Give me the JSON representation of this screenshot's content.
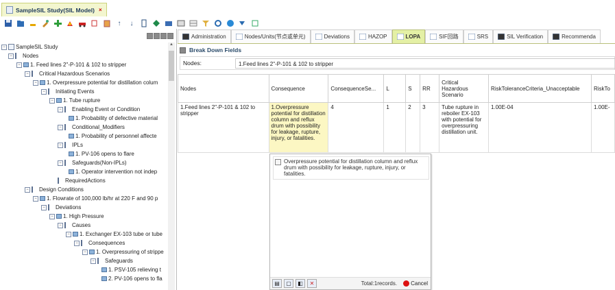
{
  "window": {
    "title": "SampleSIL Study(SIL Model)",
    "close": "×"
  },
  "toolbar": {
    "icons": [
      "save-icon",
      "folder-icon",
      "minus-icon",
      "tools-icon",
      "add-icon",
      "chart-icon",
      "car-icon",
      "copy-icon",
      "paste-icon",
      "up-arrow-icon",
      "down-arrow-icon",
      "bookmark-icon",
      "tag-icon",
      "card-icon",
      "grid-icon",
      "table-icon",
      "filter-icon",
      "refresh-icon",
      "info-icon",
      "dropdown-icon",
      "calendar-icon"
    ]
  },
  "tree": {
    "items": [
      {
        "label": "SampleSIL Study",
        "toggle": "⊟"
      },
      {
        "label": "Nodes",
        "toggle": "⊟"
      },
      {
        "label": "1. Feed lines 2\"-P-101 & 102 to stripper",
        "toggle": "⊟"
      },
      {
        "label": "Critical Hazardous Scenarios",
        "toggle": "⊟"
      },
      {
        "label": "1. Overpressure potential for distillation colum",
        "toggle": "⊟"
      },
      {
        "label": "Initiating Events",
        "toggle": "⊟"
      },
      {
        "label": "1. Tube rupture",
        "toggle": "⊟"
      },
      {
        "label": "Enabling Event or Condition",
        "toggle": "⊟"
      },
      {
        "label": "1. Probability of defective material",
        "toggle": ""
      },
      {
        "label": "Conditional_Modifiers",
        "toggle": "⊟"
      },
      {
        "label": "1. Probability of personnel affecte",
        "toggle": ""
      },
      {
        "label": "IPLs",
        "toggle": "⊟"
      },
      {
        "label": "1. PV-106 opens to flare",
        "toggle": ""
      },
      {
        "label": "Safeguards(Non-IPLs)",
        "toggle": "⊟"
      },
      {
        "label": "1. Operator intervention not indep",
        "toggle": ""
      },
      {
        "label": "RequiredActions",
        "toggle": ""
      },
      {
        "label": "Design Conditions",
        "toggle": "⊟"
      },
      {
        "label": "1. Flowrate of 100,000 lb/hr at 220 F and 90 p",
        "toggle": "⊟"
      },
      {
        "label": "Deviations",
        "toggle": "⊟"
      },
      {
        "label": "1. High Pressure",
        "toggle": "⊟"
      },
      {
        "label": "Causes",
        "toggle": "⊟"
      },
      {
        "label": "1. Exchanger EX-103 tube or tube",
        "toggle": "⊟"
      },
      {
        "label": "Consequences",
        "toggle": "⊟"
      },
      {
        "label": "1. Overpressuring of strippe",
        "toggle": "⊟"
      },
      {
        "label": "Safeguards",
        "toggle": "⊟"
      },
      {
        "label": "1. PSV-105 relieving t",
        "toggle": ""
      },
      {
        "label": "2. PV-106 opens to fla",
        "toggle": ""
      }
    ]
  },
  "tabs": [
    {
      "label": "Administration"
    },
    {
      "label": "Nodes/Units(节点或单元)"
    },
    {
      "label": "Deviations"
    },
    {
      "label": "HAZOP"
    },
    {
      "label": "LOPA",
      "active": true
    },
    {
      "label": "SIF回路"
    },
    {
      "label": "SRS"
    },
    {
      "label": "SIL Verification"
    },
    {
      "label": "Recommenda"
    }
  ],
  "section": {
    "title": "Break Down Fields"
  },
  "nodes_field": {
    "label": "Nodes:",
    "value": "1.Feed lines 2\"-P-101 & 102  to stripper"
  },
  "grid": {
    "headers": [
      "Nodes",
      "Consequence",
      "ConsequenceSe...",
      "L",
      "S",
      "RR",
      "Critical Hazardous Scenario",
      "RiskToleranceCriteria_Unacceptable",
      "RiskTo"
    ],
    "rows": [
      [
        "1.Feed lines 2\"-P-101 & 102 to stripper",
        "1.Overpressure potential for distillation column and reflux drum with possibility for leakage, rupture, injury, or fatalities.",
        "4",
        "1",
        "2",
        "3",
        "Tube rupture in reboiler EX-103 with potential for overpressuring distillation unit.",
        "1.00E-04",
        "1.00E-"
      ]
    ]
  },
  "popup": {
    "option": "Overpressure potential for distillation column and reflux drum with possibility for leakage, rupture, injury, or fatalities.",
    "total": "Total:1records.",
    "cancel": "Cancel"
  }
}
